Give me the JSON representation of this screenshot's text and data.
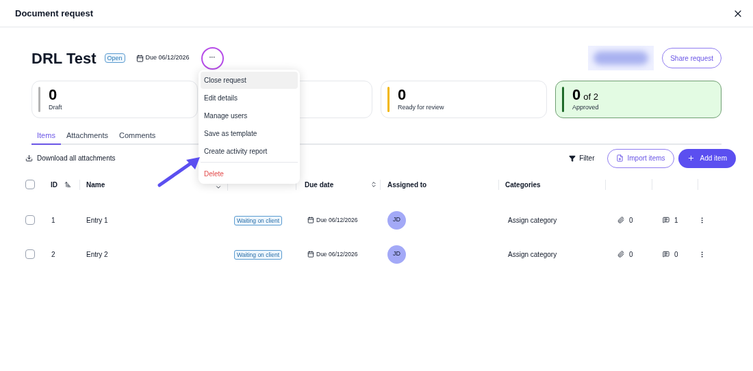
{
  "dialog": {
    "title": "Document request"
  },
  "request": {
    "title": "DRL Test",
    "status": "Open",
    "due": "Due 06/12/2026",
    "more_label": "···",
    "share_label": "Share request"
  },
  "menu": {
    "items": [
      {
        "label": "Close request",
        "kind": "normal",
        "selected": true
      },
      {
        "label": "Edit details",
        "kind": "normal",
        "selected": false
      },
      {
        "label": "Manage users",
        "kind": "normal",
        "selected": false
      },
      {
        "label": "Save as template",
        "kind": "normal",
        "selected": false
      },
      {
        "label": "Create activity report",
        "kind": "normal",
        "selected": false
      },
      {
        "label": "Delete",
        "kind": "danger",
        "selected": false
      }
    ]
  },
  "stats": [
    {
      "kind": "card",
      "value": "0",
      "label": "Draft",
      "color": "#b5b5b5",
      "highlighted": false
    },
    {
      "kind": "covered"
    },
    {
      "kind": "card",
      "value": "0",
      "label": "Ready for review",
      "color": "#f2b705",
      "highlighted": false
    },
    {
      "kind": "card",
      "value": "0",
      "of": "of 2",
      "label": "Approved",
      "color": "#1f6b2a",
      "highlighted": true
    }
  ],
  "tabs": [
    {
      "label": "Items",
      "selected": true
    },
    {
      "label": "Attachments",
      "selected": false
    },
    {
      "label": "Comments",
      "selected": false
    }
  ],
  "toolbar": {
    "download": "Download all attachments",
    "filter": "Filter",
    "import": "Import items",
    "add": "Add item"
  },
  "table": {
    "all_selected": false,
    "columns": {
      "id": "ID",
      "name": "Name",
      "due": "Due date",
      "assigned": "Assigned to",
      "categories": "Categories"
    },
    "rows": [
      {
        "id": "1",
        "name": "Entry 1",
        "status": "Waiting on client",
        "due": "Due 06/12/2026",
        "assignee": "JD",
        "category": "Assign category",
        "attachments": "0",
        "comments": "1",
        "checked": false
      },
      {
        "id": "2",
        "name": "Entry 2",
        "status": "Waiting on client",
        "due": "Due 06/12/2026",
        "assignee": "JD",
        "category": "Assign category",
        "attachments": "0",
        "comments": "0",
        "checked": false
      }
    ]
  }
}
